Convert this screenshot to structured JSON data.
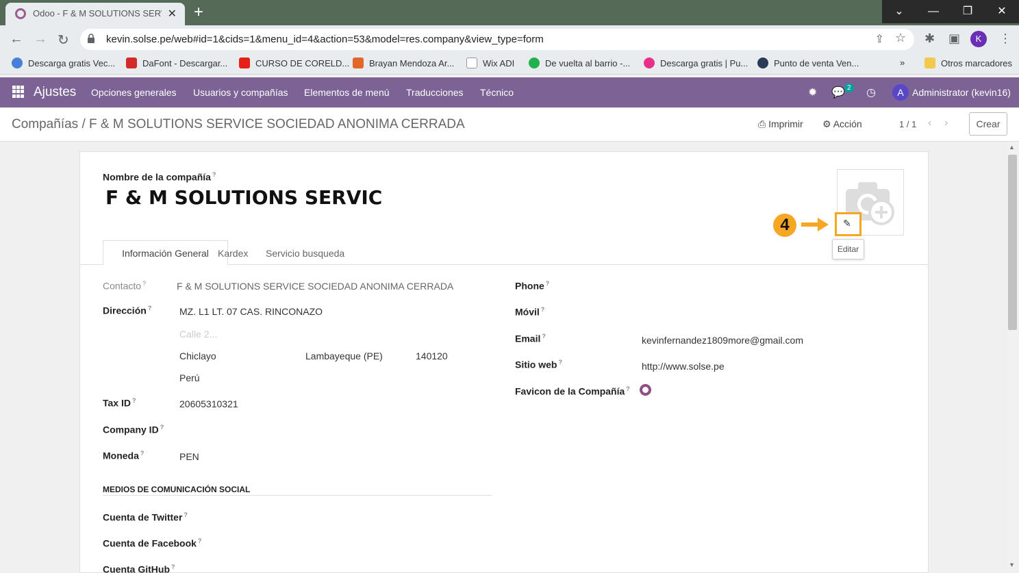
{
  "browser": {
    "tab_title": "Odoo - F & M SOLUTIONS SERV",
    "url": "kevin.solse.pe/web#id=1&cids=1&menu_id=4&action=53&model=res.company&view_type=form",
    "profile_initial": "K",
    "bookmarks": [
      "Descarga gratis Vec...",
      "DaFont - Descargar...",
      "CURSO DE CORELD...",
      "Brayan Mendoza Ar...",
      "Wix ADI",
      "De vuelta al barrio -...",
      "Descarga gratis | Pu...",
      "Punto de venta Ven...",
      "Otros marcadores"
    ],
    "bookmarks_more": "»"
  },
  "navbar": {
    "app_name": "Ajustes",
    "menus": [
      "Opciones generales",
      "Usuarios y compañías",
      "Elementos de menú",
      "Traducciones",
      "Técnico"
    ],
    "chat_badge": "2",
    "user_initial": "A",
    "user_name": "Administrator (kevin16)"
  },
  "control_panel": {
    "breadcrumb": "Compañías / F & M SOLUTIONS SERVICE SOCIEDAD ANONIMA CERRADA",
    "print_label": "Imprimir",
    "action_label": "Acción",
    "pager": "1 / 1",
    "create_label": "Crear"
  },
  "form": {
    "name_label": "Nombre de la compañía",
    "name_value": "F & M SOLUTIONS SERVIC",
    "edit_tooltip": "Editar",
    "step_number": "4",
    "tabs": [
      "Información General",
      "Kardex",
      "Servicio busqueda"
    ],
    "contacto_label": "Contacto",
    "contacto_value": "F & M SOLUTIONS SERVICE SOCIEDAD ANONIMA CERRADA",
    "direccion_label": "Dirección",
    "street": "MZ. L1 LT. 07 CAS. RINCONAZO",
    "street2_placeholder": "Calle 2...",
    "city": "Chiclayo",
    "state": "Lambayeque (PE)",
    "zip": "140120",
    "country": "Perú",
    "tax_label": "Tax ID",
    "tax_value": "20605310321",
    "company_id_label": "Company ID",
    "moneda_label": "Moneda",
    "moneda_value": "PEN",
    "social_header": "MEDIOS DE COMUNICACIÓN SOCIAL",
    "twitter_label": "Cuenta de Twitter",
    "facebook_label": "Cuenta de Facebook",
    "github_label": "Cuenta GitHub",
    "phone_label": "Phone",
    "movil_label": "Móvil",
    "email_label": "Email",
    "email_value": "kevinfernandez1809more@gmail.com",
    "web_label": "Sitio web",
    "web_value": "http://www.solse.pe",
    "favicon_label": "Favicon de la Compañía",
    "help_mark": "?"
  }
}
